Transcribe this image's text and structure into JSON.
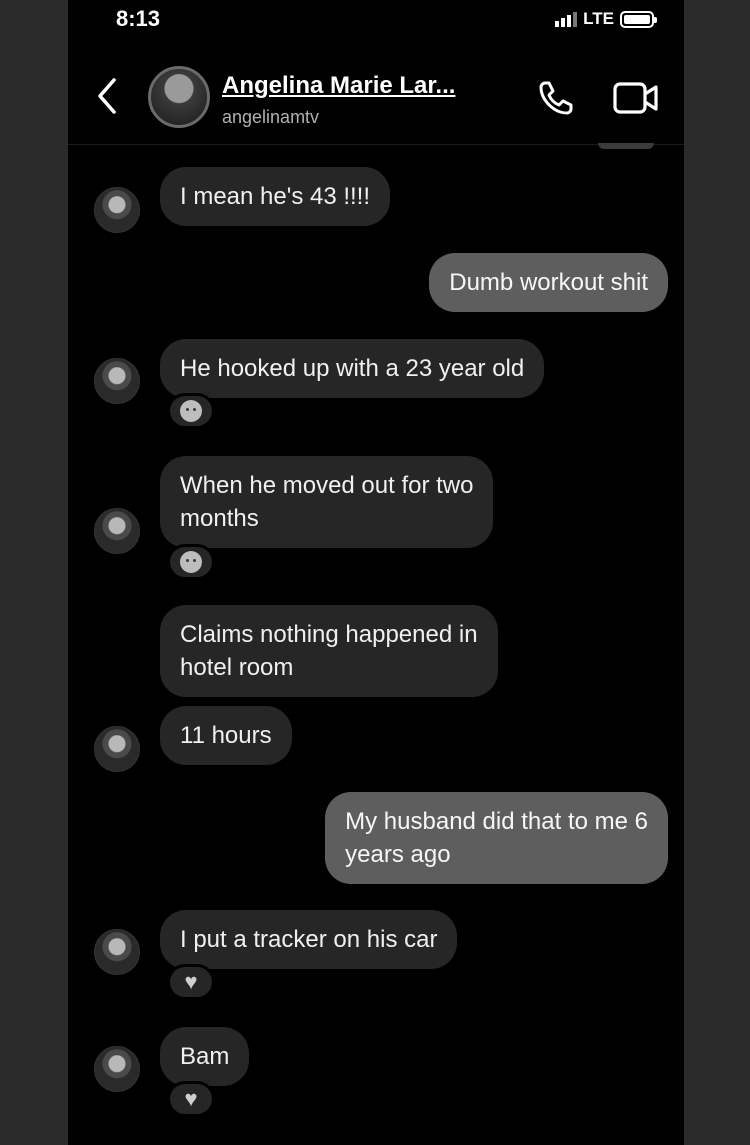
{
  "status_bar": {
    "time": "8:13",
    "network": "LTE"
  },
  "header": {
    "name": "Angelina Marie Lar...",
    "username": "angelinamtv"
  },
  "messages": [
    {
      "from": "them",
      "text": "I mean he's 43 !!!!"
    },
    {
      "from": "me",
      "text": "Dumb workout shit"
    },
    {
      "from": "them",
      "text": "He hooked up with a 23 year old",
      "reaction": "angry-face-icon"
    },
    {
      "from": "them",
      "lines": [
        "When he moved out for two",
        "months"
      ],
      "reaction": "angry-face-icon"
    },
    {
      "from": "them",
      "lines": [
        "Claims nothing happened in",
        "hotel room"
      ]
    },
    {
      "from": "them",
      "text": "11 hours"
    },
    {
      "from": "me",
      "lines": [
        "My husband did that to me 6",
        "years ago"
      ]
    },
    {
      "from": "them",
      "text": "I put a tracker on his car",
      "reaction": "heart-icon"
    },
    {
      "from": "them",
      "text": "Bam",
      "reaction": "heart-icon"
    }
  ]
}
